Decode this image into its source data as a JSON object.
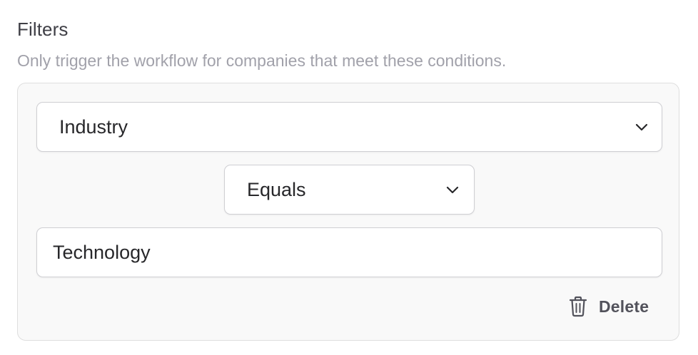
{
  "filters": {
    "title": "Filters",
    "description": "Only trigger the workflow for companies that meet these conditions.",
    "condition": {
      "field_value": "Industry",
      "operator_value": "Equals",
      "input_value": "Technology",
      "delete_label": "Delete"
    }
  },
  "icons": {
    "dropdown": "chevron-down-icon",
    "delete": "trash-icon"
  },
  "colors": {
    "card_background": "#f9f9f9",
    "border": "#cfcfd3",
    "text": "#27272a",
    "muted_text": "#a1a1aa"
  }
}
